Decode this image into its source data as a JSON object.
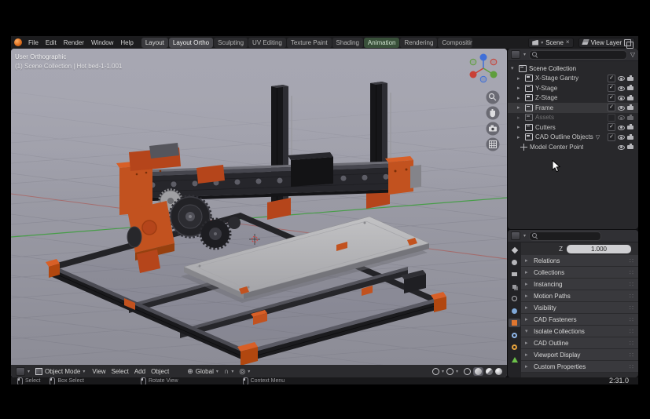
{
  "topbar": {
    "menus": [
      "File",
      "Edit",
      "Render",
      "Window",
      "Help"
    ],
    "tabs": [
      "Layout",
      "Layout Ortho",
      "Sculpting",
      "UV Editing",
      "Texture Paint",
      "Shading",
      "Animation",
      "Rendering",
      "Compositing"
    ],
    "scene_label": "Scene",
    "view_layer_label": "View Layer"
  },
  "viewport": {
    "overlay": {
      "line1": "User Orthographic",
      "line2": "(1) Scene Collection | Hot bed-1-1.001"
    },
    "footer": {
      "mode": "Object Mode",
      "menus": [
        "View",
        "Select",
        "Add",
        "Object"
      ],
      "orientation": "Global"
    }
  },
  "outliner": {
    "rows": [
      {
        "label": "Scene Collection"
      },
      {
        "label": "X-Stage Gantry"
      },
      {
        "label": "Y-Stage"
      },
      {
        "label": "Z-Stage"
      },
      {
        "label": "Frame"
      },
      {
        "label": "Assets"
      },
      {
        "label": "Cutters"
      },
      {
        "label": "CAD Outline Objects"
      },
      {
        "label": "Model Center Point"
      }
    ]
  },
  "properties": {
    "z_label": "Z",
    "z_value": "1.000",
    "sections": [
      "Relations",
      "Collections",
      "Instancing",
      "Motion Paths",
      "Visibility",
      "CAD Fasteners",
      "Isolate Collections",
      "CAD Outline",
      "Viewport Display",
      "Custom Properties"
    ]
  },
  "statusbar": {
    "items": [
      "Select",
      "Box Select",
      "Rotate View",
      "Context Menu"
    ],
    "timer": "2:31.0"
  },
  "icons": {
    "collapse": "▸",
    "expand": "▾",
    "dropdown": "▾",
    "funnel": "▽",
    "close": "×",
    "check": "✓",
    "orientation_globe": "⊕",
    "proportional": "◎",
    "magnet": "∩",
    "grip": "∷"
  },
  "colors": {
    "accent_orange": "#c2521f",
    "axis_x": "#c94035",
    "axis_y": "#5f9e3d",
    "axis_z": "#3f6fd8",
    "viewport_top": "#a7a7b2",
    "viewport_bottom": "#8b8b95"
  }
}
